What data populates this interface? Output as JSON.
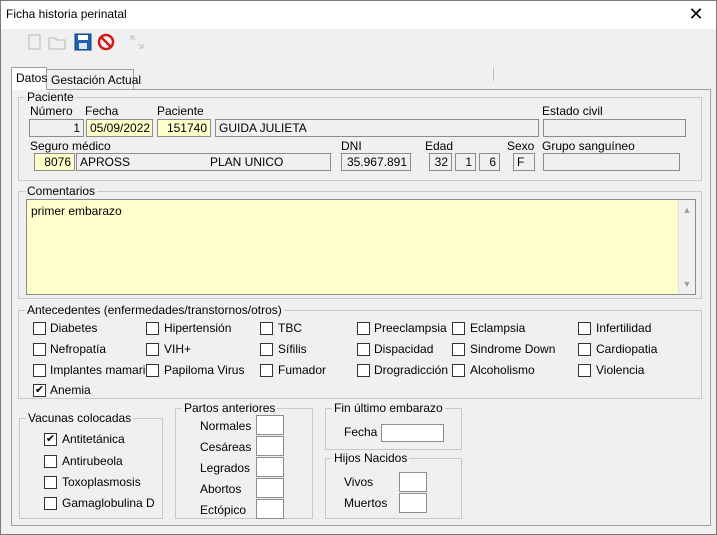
{
  "window": {
    "title": "Ficha historia perinatal",
    "close_label": "✕"
  },
  "toolbar": {
    "icons": [
      "new-document-icon",
      "open-folder-icon",
      "save-icon",
      "cancel-icon",
      "expand-icon"
    ]
  },
  "tabs": [
    {
      "label": "Datos",
      "active": true
    },
    {
      "label": "Gestación Actual",
      "active": false
    }
  ],
  "paciente": {
    "group_title": "Paciente",
    "numero_label": "Número",
    "numero": "1",
    "fecha_label": "Fecha",
    "fecha": "05/09/2022",
    "paciente_label": "Paciente",
    "paciente_id": "151740",
    "paciente_nombre": "GUIDA JULIETA",
    "estado_civil_label": "Estado civil",
    "estado_civil": "",
    "seguro_label": "Seguro médico",
    "seguro_id": "8076",
    "seguro_nombre": "APROSS",
    "seguro_plan": "PLAN UNICO",
    "dni_label": "DNI",
    "dni": "35.967.891",
    "edad_label": "Edad",
    "edad": [
      "32",
      "1",
      "6"
    ],
    "sexo_label": "Sexo",
    "sexo": "F",
    "grupo_label": "Grupo sanguíneo",
    "grupo": ""
  },
  "comentarios": {
    "group_title": "Comentarios",
    "text": "primer embarazo"
  },
  "antecedentes": {
    "group_title": "Antecedentes (enfermedades/transtornos/otros)",
    "items": [
      {
        "label": "Diabetes",
        "checked": false
      },
      {
        "label": "Hipertensión",
        "checked": false
      },
      {
        "label": "TBC",
        "checked": false
      },
      {
        "label": "Preeclampsia",
        "checked": false
      },
      {
        "label": "Eclampsia",
        "checked": false
      },
      {
        "label": "Infertilidad",
        "checked": false
      },
      {
        "label": "Nefropatía",
        "checked": false
      },
      {
        "label": "VIH+",
        "checked": false
      },
      {
        "label": "Sífilis",
        "checked": false
      },
      {
        "label": "Dispacidad",
        "checked": false
      },
      {
        "label": "Sindrome Down",
        "checked": false
      },
      {
        "label": "Cardiopatia",
        "checked": false
      },
      {
        "label": "Implantes mamarios",
        "checked": false
      },
      {
        "label": "Papiloma Virus",
        "checked": false
      },
      {
        "label": "Fumador",
        "checked": false
      },
      {
        "label": "Drogradicción",
        "checked": false
      },
      {
        "label": "Alcoholismo",
        "checked": false
      },
      {
        "label": "Violencia",
        "checked": false
      },
      {
        "label": "Anemia",
        "checked": true
      }
    ]
  },
  "vacunas": {
    "group_title": "Vacunas colocadas",
    "items": [
      {
        "label": "Antitetánica",
        "checked": true
      },
      {
        "label": "Antirubeola",
        "checked": false
      },
      {
        "label": "Toxoplasmosis",
        "checked": false
      },
      {
        "label": "Gamaglobulina D",
        "checked": false
      }
    ]
  },
  "partos": {
    "group_title": "Partos anteriores",
    "items": [
      {
        "label": "Normales",
        "value": ""
      },
      {
        "label": "Cesáreas",
        "value": ""
      },
      {
        "label": "Legrados",
        "value": ""
      },
      {
        "label": "Abortos",
        "value": ""
      },
      {
        "label": "Ectópico",
        "value": ""
      }
    ]
  },
  "fin_embarazo": {
    "group_title": "Fin último embarazo",
    "fecha_label": "Fecha",
    "fecha": ""
  },
  "hijos": {
    "group_title": "Hijos Nacidos",
    "vivos_label": "Vivos",
    "vivos": "",
    "muertos_label": "Muertos",
    "muertos": ""
  }
}
